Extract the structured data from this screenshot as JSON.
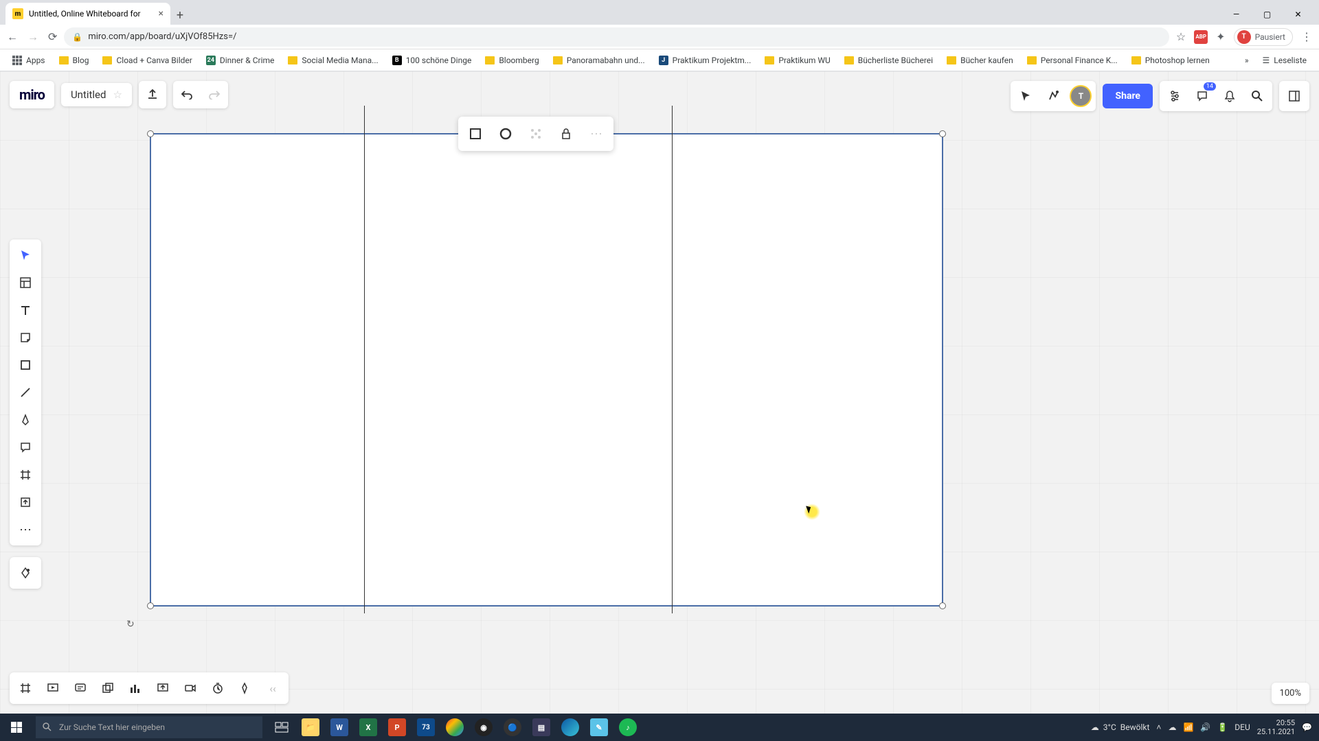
{
  "browser": {
    "tab_title": "Untitled, Online Whiteboard for",
    "url": "miro.com/app/board/uXjVOf85Hzs=/",
    "profile_label": "Pausiert",
    "apps_label": "Apps",
    "reading_list": "Leseliste",
    "bookmarks": [
      "Blog",
      "Cload + Canva Bilder",
      "Dinner & Crime",
      "Social Media Mana...",
      "100 schöne Dinge",
      "Bloomberg",
      "Panoramabahn und...",
      "Praktikum Projektm...",
      "Praktikum WU",
      "Bücherliste Bücherei",
      "Bücher kaufen",
      "Personal Finance K...",
      "Photoshop lernen"
    ]
  },
  "miro": {
    "logo": "miro",
    "board_title": "Untitled",
    "share_label": "Share",
    "zoom": "100%",
    "notification_count": "14"
  },
  "taskbar": {
    "search_placeholder": "Zur Suche Text hier eingeben",
    "weather_temp": "3°C",
    "weather_label": "Bewölkt",
    "lang": "DEU",
    "time": "20:55",
    "date": "25.11.2021",
    "calendar_badge": "73"
  }
}
